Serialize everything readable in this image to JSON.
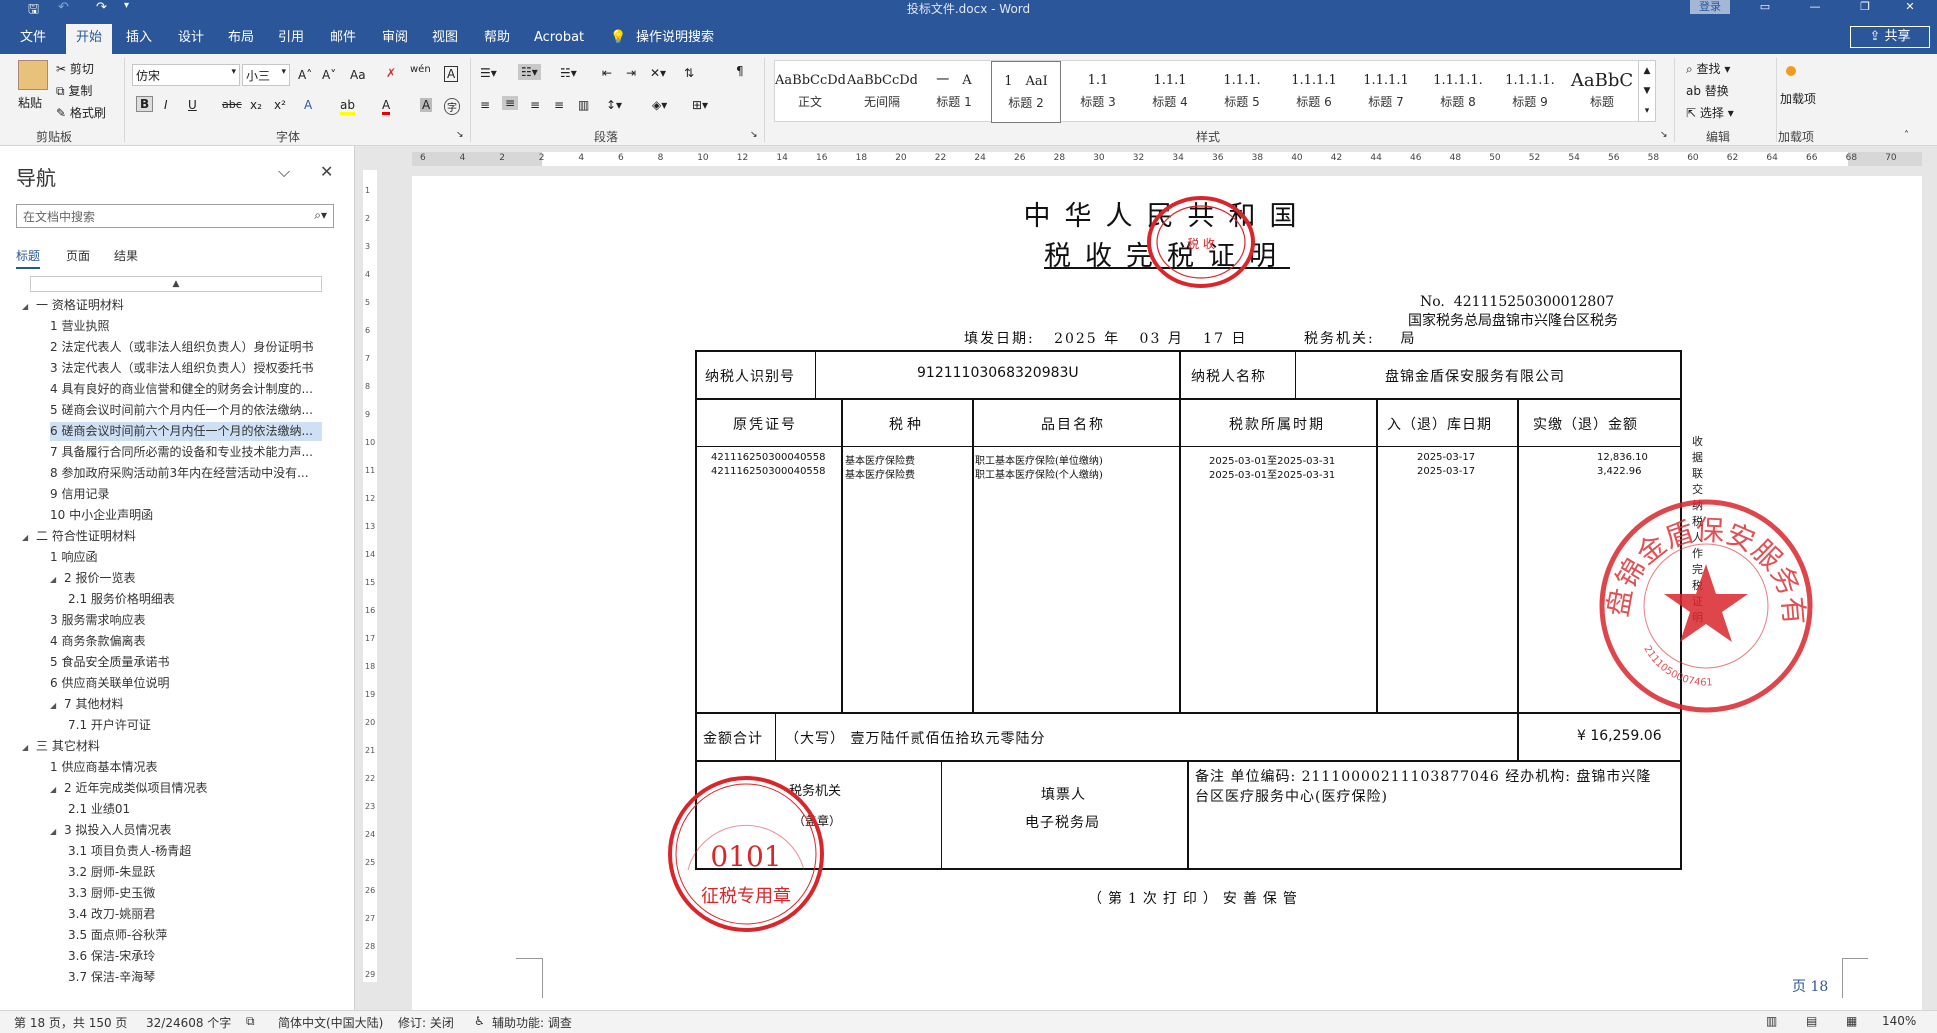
{
  "app": {
    "doc_title": "投标文件.docx - Word",
    "login": "登录",
    "share": "共享"
  },
  "tabs": [
    "文件",
    "开始",
    "插入",
    "设计",
    "布局",
    "引用",
    "邮件",
    "审阅",
    "视图",
    "帮助",
    "Acrobat",
    "操作说明搜索"
  ],
  "ribbon": {
    "clipboard": {
      "paste": "粘贴",
      "cut": "剪切",
      "copy": "复制",
      "format_painter": "格式刷",
      "label": "剪贴板"
    },
    "font": {
      "name": "仿宋",
      "size": "小三",
      "label": "字体",
      "bold": "B",
      "italic": "I",
      "underline": "U",
      "strike": "abc",
      "sub": "x₂",
      "sup": "x²",
      "grow": "A˄",
      "shrink": "A˅",
      "case": "Aa",
      "phonetic": "wén",
      "border_char": "A",
      "effects": "A",
      "highlight": "ab",
      "color": "A",
      "shade": "A",
      "enclose": "字"
    },
    "paragraph": {
      "label": "段落"
    },
    "styles": {
      "label": "样式",
      "items": [
        {
          "sample": "AaBbCcDdI",
          "name": "正文"
        },
        {
          "sample": "AaBbCcDdI",
          "name": "无间隔"
        },
        {
          "sample": "一　A",
          "name": "标题 1"
        },
        {
          "sample": "1　AaI",
          "name": "标题 2"
        },
        {
          "sample": "1.1",
          "name": "标题 3"
        },
        {
          "sample": "1.1.1",
          "name": "标题 4"
        },
        {
          "sample": "1.1.1.",
          "name": "标题 5"
        },
        {
          "sample": "1.1.1.1",
          "name": "标题 6"
        },
        {
          "sample": "1.1.1.1",
          "name": "标题 7"
        },
        {
          "sample": "1.1.1.1.",
          "name": "标题 8"
        },
        {
          "sample": "1.1.1.1.",
          "name": "标题 9"
        },
        {
          "sample": "AaBbC",
          "name": "标题"
        }
      ]
    },
    "editing": {
      "find": "查找",
      "replace": "替换",
      "select": "选择",
      "label": "编辑"
    },
    "addins": {
      "load": "加载项",
      "label": "加载项"
    }
  },
  "nav": {
    "title": "导航",
    "search_placeholder": "在文档中搜索",
    "tabs": [
      "标题",
      "页面",
      "结果"
    ],
    "items": [
      {
        "text": "一 资格证明材料",
        "level": 0,
        "tri": "◢"
      },
      {
        "text": "1 营业执照",
        "level": 1,
        "tri": ""
      },
      {
        "text": "2 法定代表人（或非法人组织负责人）身份证明书",
        "level": 1,
        "tri": ""
      },
      {
        "text": "3 法定代表人（或非法人组织负责人）授权委托书",
        "level": 1,
        "tri": ""
      },
      {
        "text": "4 具有良好的商业信誉和健全的财务会计制度的...",
        "level": 1,
        "tri": ""
      },
      {
        "text": "5 磋商会议时间前六个月内任一个月的依法缴纳...",
        "level": 1,
        "tri": ""
      },
      {
        "text": "6 磋商会议时间前六个月内任一个月的依法缴纳...",
        "level": 1,
        "tri": "",
        "selected": true
      },
      {
        "text": "7 具备履行合同所必需的设备和专业技术能力声...",
        "level": 1,
        "tri": ""
      },
      {
        "text": "8 参加政府采购活动前3年内在经营活动中没有...",
        "level": 1,
        "tri": ""
      },
      {
        "text": "9 信用记录",
        "level": 1,
        "tri": ""
      },
      {
        "text": "10 中小企业声明函",
        "level": 1,
        "tri": ""
      },
      {
        "text": "二 符合性证明材料",
        "level": 0,
        "tri": "◢"
      },
      {
        "text": "1 响应函",
        "level": 1,
        "tri": ""
      },
      {
        "text": "2 报价一览表",
        "level": 1,
        "tri": "◢"
      },
      {
        "text": "2.1 服务价格明细表",
        "level": 2,
        "tri": ""
      },
      {
        "text": "3 服务需求响应表",
        "level": 1,
        "tri": ""
      },
      {
        "text": "4 商务条款偏离表",
        "level": 1,
        "tri": ""
      },
      {
        "text": "5 食品安全质量承诺书",
        "level": 1,
        "tri": ""
      },
      {
        "text": "6 供应商关联单位说明",
        "level": 1,
        "tri": ""
      },
      {
        "text": "7 其他材料",
        "level": 1,
        "tri": "◢"
      },
      {
        "text": "7.1 开户许可证",
        "level": 2,
        "tri": ""
      },
      {
        "text": "三 其它材料",
        "level": 0,
        "tri": "◢"
      },
      {
        "text": "1 供应商基本情况表",
        "level": 1,
        "tri": ""
      },
      {
        "text": "2 近年完成类似项目情况表",
        "level": 1,
        "tri": "◢"
      },
      {
        "text": "2.1 业绩01",
        "level": 2,
        "tri": ""
      },
      {
        "text": "3 拟投入人员情况表",
        "level": 1,
        "tri": "◢"
      },
      {
        "text": "3.1 项目负责人-杨青超",
        "level": 2,
        "tri": ""
      },
      {
        "text": "3.2 厨师-朱显跃",
        "level": 2,
        "tri": ""
      },
      {
        "text": "3.3 厨师-史玉微",
        "level": 2,
        "tri": ""
      },
      {
        "text": "3.4 改刀-姚丽君",
        "level": 2,
        "tri": ""
      },
      {
        "text": "3.5 面点师-谷秋萍",
        "level": 2,
        "tri": ""
      },
      {
        "text": "3.6 保洁-宋承玲",
        "level": 2,
        "tri": ""
      },
      {
        "text": "3.7 保洁-辛海琴",
        "level": 2,
        "tri": ""
      }
    ]
  },
  "ruler": {
    "h": [
      "6",
      "4",
      "2",
      "2",
      "4",
      "6",
      "8",
      "10",
      "12",
      "14",
      "16",
      "18",
      "20",
      "22",
      "24",
      "26",
      "28",
      "30",
      "32",
      "34",
      "36",
      "38",
      "40",
      "42",
      "44",
      "46",
      "48",
      "50",
      "52",
      "54",
      "56",
      "58",
      "60",
      "62",
      "64",
      "66",
      "68",
      "70"
    ],
    "v": [
      "1",
      "2",
      "3",
      "4",
      "5",
      "6",
      "7",
      "8",
      "9",
      "10",
      "11",
      "12",
      "13",
      "14",
      "15",
      "16",
      "17",
      "18",
      "19",
      "20",
      "21",
      "22",
      "23",
      "24",
      "25",
      "26",
      "27",
      "28",
      "29"
    ]
  },
  "certificate": {
    "title1": "中华人民共和国",
    "title2": "税收完税证明",
    "no_label": "No.",
    "no": "421115250300012807",
    "tax_office_name": "国家税务总局盘锦市兴隆台区税务",
    "date_label": "填发日期:",
    "year": "2025",
    "year_unit": "年",
    "month": "03",
    "month_unit": "月",
    "day": "17",
    "day_unit": "日",
    "office_label": "税务机关:",
    "office_tail": "局",
    "taxpayer_id_label": "纳税人识别号",
    "taxpayer_id": "91211103068320983U",
    "taxpayer_name_label": "纳税人名称",
    "taxpayer_name": "盘锦金盾保安服务有限公司",
    "headers": [
      "原凭证号",
      "税种",
      "品目名称",
      "税款所属时期",
      "入（退）库日期",
      "实缴（退）金额"
    ],
    "rows": [
      {
        "voucher": "421116250300040558",
        "tax": "基本医疗保险费",
        "item": "职工基本医疗保险(单位缴纳)",
        "period": "2025-03-01至2025-03-31",
        "date": "2025-03-17",
        "amount": "12,836.10"
      },
      {
        "voucher": "421116250300040558",
        "tax": "基本医疗保险费",
        "item": "职工基本医疗保险(个人缴纳)",
        "period": "2025-03-01至2025-03-31",
        "date": "2025-03-17",
        "amount": "3,422.96"
      }
    ],
    "total_label": "金额合计",
    "total_words": "（大写） 壹万陆仟贰佰伍拾玖元零陆分",
    "total_amount": "¥ 16,259.06",
    "seal_label": "税务机关",
    "seal_sub": "（盖章）",
    "issuer_label": "填票人",
    "issuer": "电子税务局",
    "remark": "备注 单位编码: 2111000021110387704６ 经办机构: 盘锦市兴隆台区医疗服务中心(医疗保险)",
    "remark_line1": "备注 单位编码: 21110000211103877046 经办机构: 盘锦市兴隆",
    "remark_line2": "台区医疗服务中心(医疗保险)",
    "footer": "（第1次打印）安善保管",
    "side_note": "收据联 交纳税人作完税证明",
    "stamp_top_center": "税 收",
    "stamp_company": "盘锦金盾保安服务有限公司",
    "stamp_company_code": "2111050007461",
    "stamp_bottom_code": "0101",
    "stamp_bottom_text": "征税专用章",
    "page_mark": "页 18"
  },
  "status": {
    "page": "第 18 页，共 150 页",
    "words": "32/24608 个字",
    "lang": "简体中文(中国大陆)",
    "track": "修订: 关闭",
    "access": "辅助功能: 调查",
    "zoom": "140%"
  },
  "colors": {
    "accent": "#2b579a",
    "stamp": "#d9262b"
  }
}
